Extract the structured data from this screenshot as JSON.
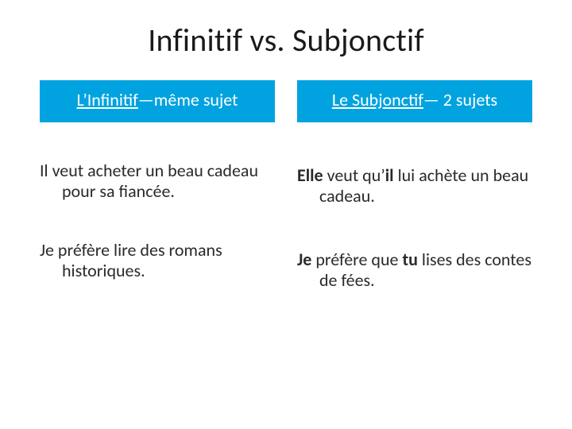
{
  "title": "Infinitif vs. Subjonctif",
  "left": {
    "header_underlined": "L’Infinitif",
    "header_rest": "—même sujet",
    "ex1_line": "Il veut acheter un beau cadeau pour sa fiancée.",
    "ex2_line": "Je préfère lire des romans historiques."
  },
  "right": {
    "header_underlined": "Le Subjonctif",
    "header_rest": "— 2 sujets",
    "ex1_b1": "Elle",
    "ex1_mid": " veut qu’",
    "ex1_b2": "il",
    "ex1_rest": " lui achète un beau cadeau.",
    "ex2_b1": "Je",
    "ex2_mid": " préfère que ",
    "ex2_b2": "tu",
    "ex2_rest": " lises des contes de fées."
  }
}
